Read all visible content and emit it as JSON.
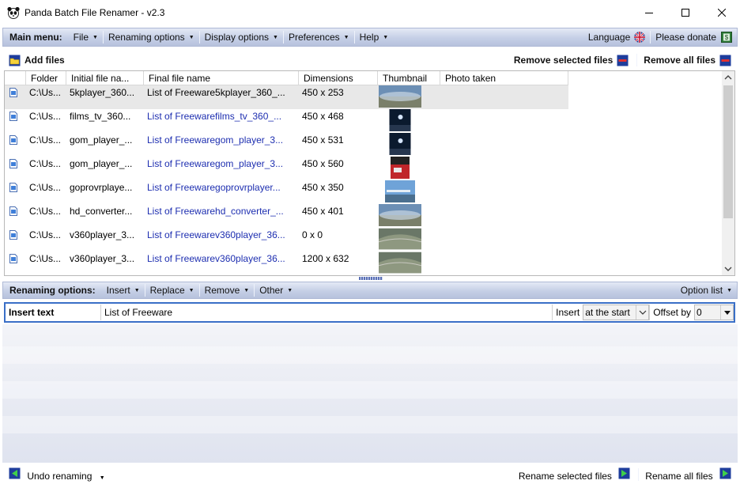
{
  "window": {
    "title": "Panda Batch File Renamer - v2.3",
    "minimize_glyph": "—",
    "maximize_glyph": "☐",
    "close_glyph": "✕"
  },
  "main_menu": {
    "label": "Main menu:",
    "items": [
      {
        "label": "File"
      },
      {
        "label": "Renaming options"
      },
      {
        "label": "Display options"
      },
      {
        "label": "Preferences"
      },
      {
        "label": "Help"
      }
    ],
    "language": "Language",
    "donate": "Please donate"
  },
  "toolbar": {
    "add_files": "Add files",
    "remove_selected": "Remove selected files",
    "remove_all": "Remove all files"
  },
  "grid": {
    "columns": [
      "Folder",
      "Initial file na...",
      "Final file name",
      "Dimensions",
      "Thumbnail",
      "Photo taken"
    ],
    "rows": [
      {
        "folder": "C:\\Us...",
        "initial": "5kplayer_360...",
        "final": "List of Freeware5kplayer_360_...",
        "dimensions": "450 x 253",
        "photo_taken": "",
        "selected": "yes",
        "thumb": "pano"
      },
      {
        "folder": "C:\\Us...",
        "initial": "films_tv_360...",
        "final": "List of Freewarefilms_tv_360_...",
        "dimensions": "450 x 468",
        "photo_taken": "",
        "selected": "no",
        "thumb": "dark"
      },
      {
        "folder": "C:\\Us...",
        "initial": "gom_player_...",
        "final": "List of Freewaregom_player_3...",
        "dimensions": "450 x 531",
        "photo_taken": "",
        "selected": "no",
        "thumb": "dark"
      },
      {
        "folder": "C:\\Us...",
        "initial": "gom_player_...",
        "final": "List of Freewaregom_player_3...",
        "dimensions": "450 x 560",
        "photo_taken": "",
        "selected": "no",
        "thumb": "red"
      },
      {
        "folder": "C:\\Us...",
        "initial": "goprovrplaye...",
        "final": "List of Freewaregoprovrplayer...",
        "dimensions": "450 x 350",
        "photo_taken": "",
        "selected": "no",
        "thumb": "sky"
      },
      {
        "folder": "C:\\Us...",
        "initial": "hd_converter...",
        "final": "List of Freewarehd_converter_...",
        "dimensions": "450 x 401",
        "photo_taken": "",
        "selected": "no",
        "thumb": "pano"
      },
      {
        "folder": "C:\\Us...",
        "initial": "v360player_3...",
        "final": "List of Freewarev360player_36...",
        "dimensions": "0 x 0",
        "photo_taken": "",
        "selected": "no",
        "thumb": "aerial"
      },
      {
        "folder": "C:\\Us...",
        "initial": "v360player_3...",
        "final": "List of Freewarev360player_36...",
        "dimensions": "1200 x 632",
        "photo_taken": "",
        "selected": "no",
        "thumb": "aerial"
      }
    ]
  },
  "renaming_options": {
    "label": "Renaming options:",
    "items": [
      {
        "label": "Insert"
      },
      {
        "label": "Replace"
      },
      {
        "label": "Remove"
      },
      {
        "label": "Other"
      }
    ],
    "option_list": "Option list"
  },
  "insert_text": {
    "label": "Insert text",
    "value": "List of Freeware",
    "insert_label": "Insert",
    "position": "at the start",
    "offset_label": "Offset by",
    "offset_value": "0"
  },
  "bottom": {
    "undo": "Undo renaming",
    "rename_selected": "Rename selected files",
    "rename_all": "Rename all files"
  },
  "colors": {
    "accent_border": "#3a6fc7",
    "final_name_text": "#1d2eb0",
    "bar_gradient_top": "#e4e9f5",
    "bar_gradient_bottom": "#b7c2dd"
  }
}
